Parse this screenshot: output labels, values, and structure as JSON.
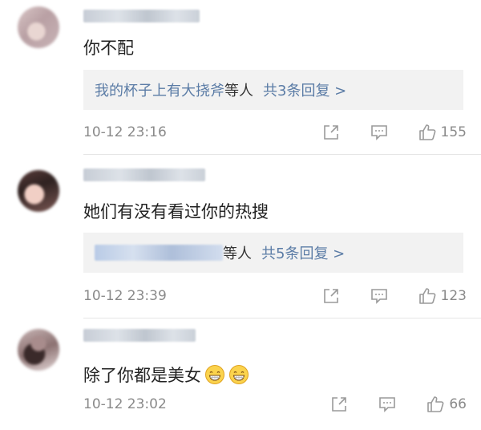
{
  "comments": [
    {
      "text": "你不配",
      "reply_names": "我的杯子上有大挠斧",
      "reply_suffix": "等人",
      "reply_count": "共3条回复 >",
      "time": "10-12 23:16",
      "likes": "155"
    },
    {
      "text": "她们有没有看过你的热搜",
      "reply_suffix": "等人",
      "reply_count": "共5条回复 >",
      "time": "10-12 23:39",
      "likes": "123"
    },
    {
      "text": "除了你都是美女",
      "emojis": [
        "grin-icon",
        "grin-icon"
      ],
      "time": "10-12 23:02",
      "likes": "66"
    }
  ],
  "icons": {
    "share": "share-icon",
    "comment": "comment-icon",
    "like": "thumbs-up-icon"
  },
  "colors": {
    "link": "#5b7ca6",
    "meta": "#8a8a8a",
    "reply_bg": "#f2f2f2"
  }
}
